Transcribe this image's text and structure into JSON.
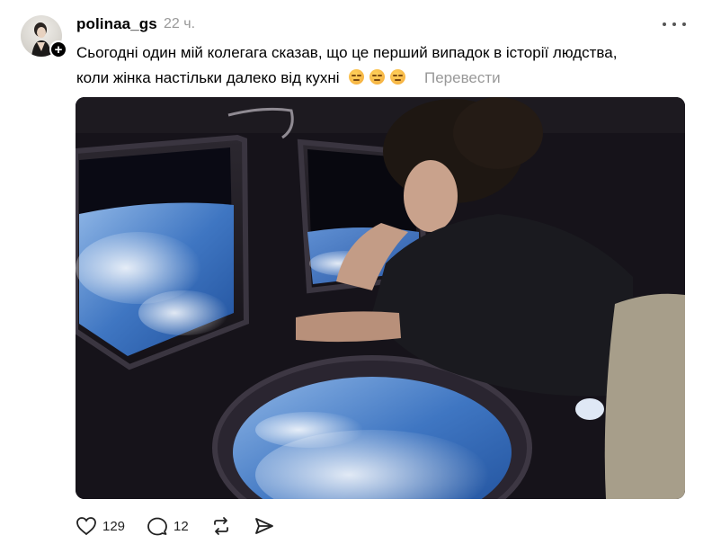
{
  "post": {
    "username": "polinaa_gs",
    "time": "22 ч.",
    "text_line1": "Сьогодні один мій колегага сказав, що це перший випадок в історії людства,",
    "text_line2": "коли жінка настільки далеко від кухні",
    "emoji_count": 3,
    "translate_label": "Перевести",
    "follow_symbol": "+"
  },
  "actions": {
    "likes": "129",
    "comments": "12"
  },
  "icons": [
    "heart-icon",
    "comment-icon",
    "repost-icon",
    "share-icon",
    "more-icon"
  ],
  "colors": {
    "text": "#000000",
    "muted": "#999999",
    "background": "#ffffff"
  }
}
